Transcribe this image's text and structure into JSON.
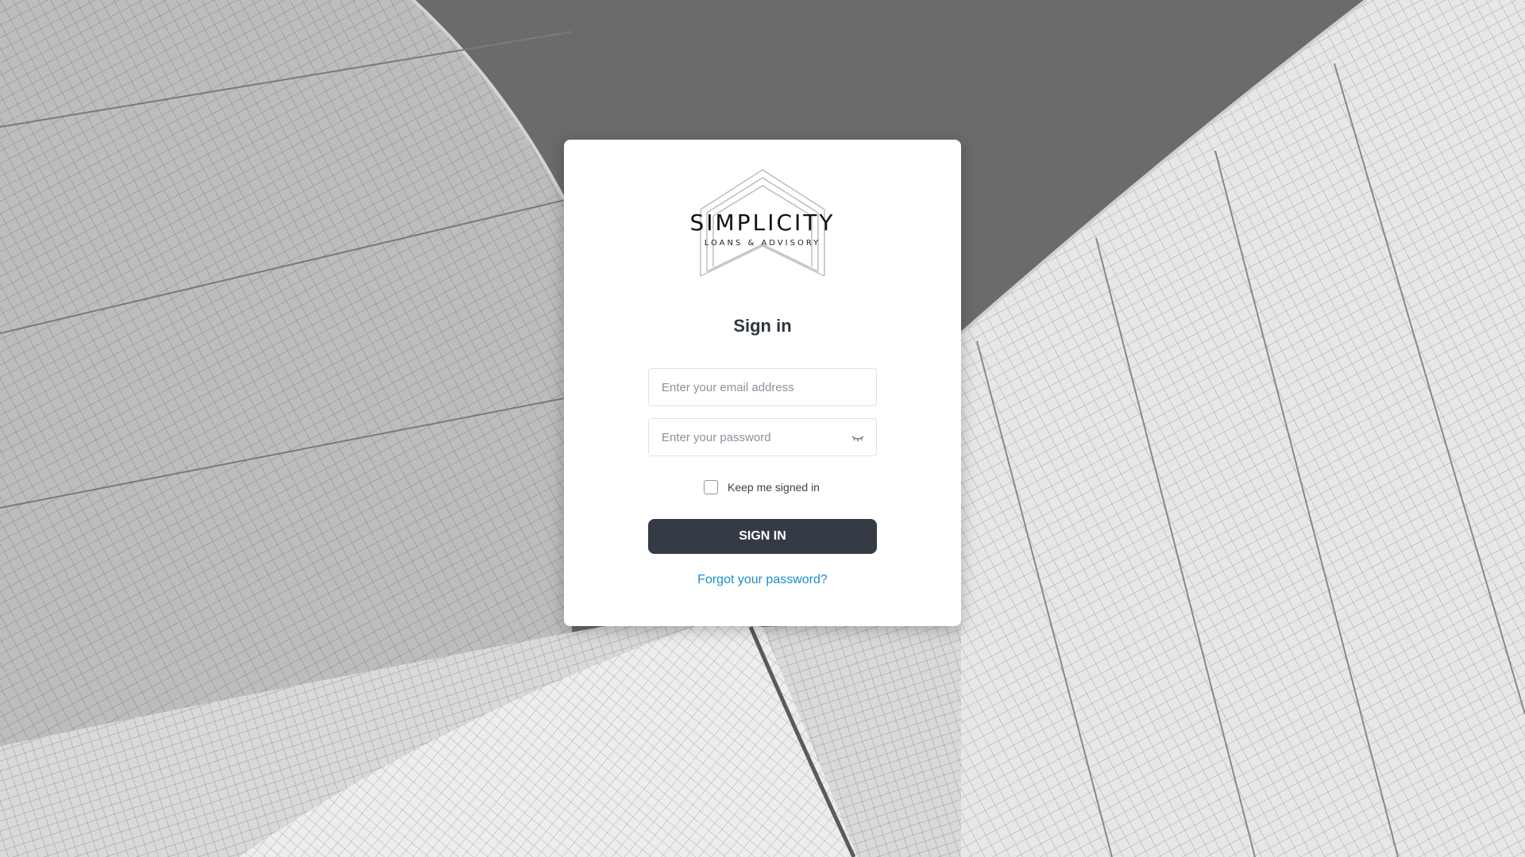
{
  "brand": {
    "name": "SIMPLICITY",
    "tagline": "LOANS & ADVISORY"
  },
  "form": {
    "title": "Sign in",
    "email_placeholder": "Enter your email address",
    "password_placeholder": "Enter your password",
    "password_toggle_icon": "eye-closed-icon",
    "keep_signed_in_label": "Keep me signed in",
    "keep_signed_in_checked": false,
    "submit_label": "SIGN IN",
    "forgot_link": "Forgot your password?"
  },
  "colors": {
    "button_bg": "#343b44",
    "link": "#1a8fc9",
    "title": "#2f3640"
  }
}
